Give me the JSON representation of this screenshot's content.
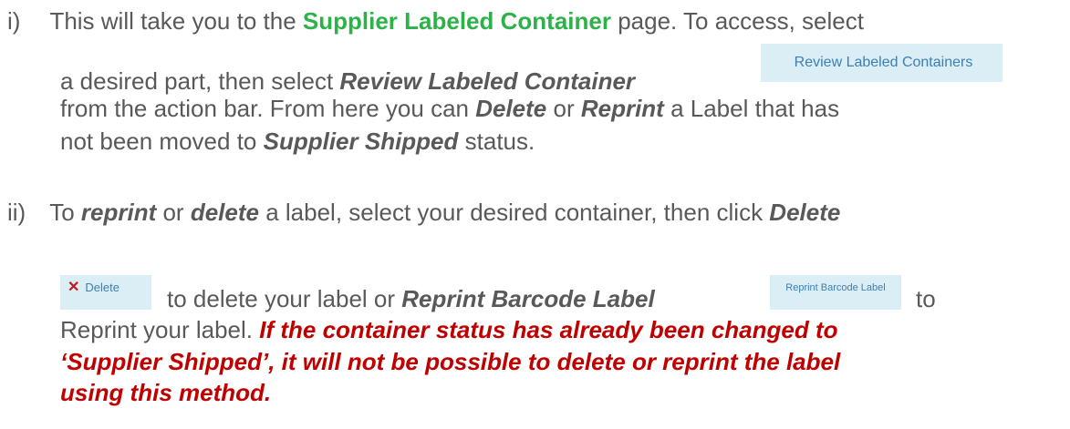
{
  "item_i": {
    "marker": "i)",
    "line1": {
      "t1": "This will take you to the ",
      "t2": "Supplier Labeled Container",
      "t3": " page. To access, select"
    },
    "line2": {
      "t1": "a desired part, then select ",
      "t2": "Review Labeled Container"
    },
    "line3": {
      "t1": "from the action bar. From here you can ",
      "t2": "Delete",
      "t3": " or ",
      "t4": "Reprint",
      "t5": " a Label that has"
    },
    "line4": {
      "t1": "not been moved to ",
      "t2": "Supplier Shipped",
      "t3": " status."
    },
    "review_button_label": "Review Labeled Containers"
  },
  "item_ii": {
    "marker": "ii)",
    "line1": {
      "t1": "To ",
      "t2": "reprint",
      "t3": " or ",
      "t4": "delete",
      "t5": " a label, select your desired container, then click ",
      "t6": "Delete"
    },
    "line2": {
      "t1": "to delete your label or ",
      "t2": "Reprint Barcode Label",
      "t3": "to"
    },
    "line3": {
      "t1": "Reprint your label. ",
      "t2": "If the container status has already been changed to"
    },
    "line4": "‘Supplier Shipped’, it will not be possible to delete or reprint the label",
    "line5": "using this method.",
    "delete_button_label": "Delete",
    "reprint_button_label": "Reprint Barcode Label"
  },
  "colors": {
    "body_text": "#595959",
    "green_highlight": "#2db24a",
    "red_warning": "#c00000",
    "button_bg": "#dbeef6",
    "button_text": "#3c7fb3",
    "delete_x": "#c0181d"
  },
  "icons": {
    "delete": "close-x-icon"
  }
}
